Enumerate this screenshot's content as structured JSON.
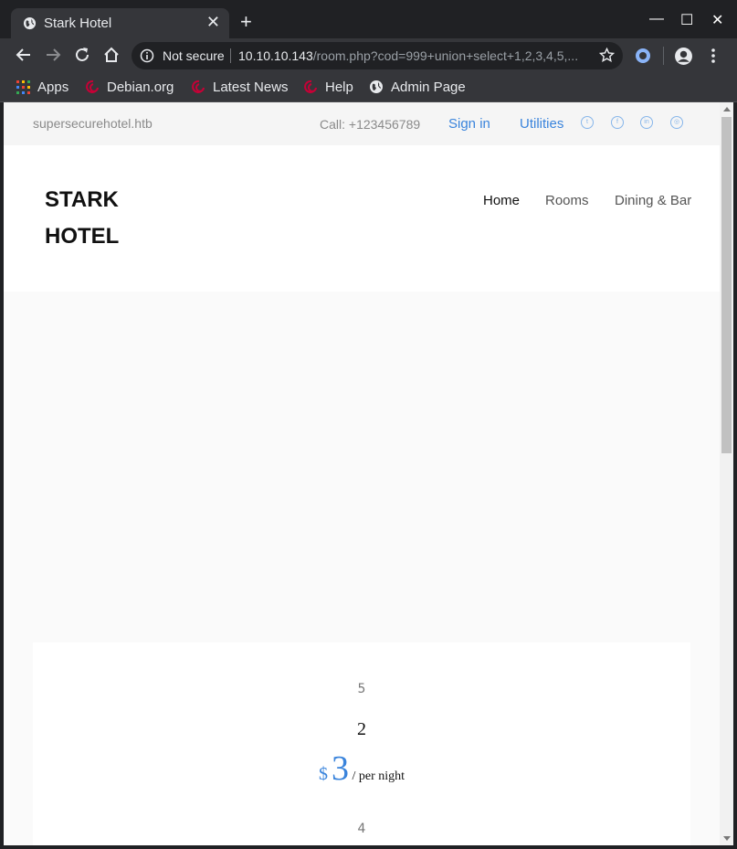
{
  "browser": {
    "tab_title": "Stark Hotel",
    "new_tab_symbol": "+",
    "close_symbol": "✕",
    "window_controls": {
      "minimize": "—",
      "maximize": "☐",
      "close": "✕"
    },
    "security_label": "Not secure",
    "url_host": "10.10.10.143",
    "url_path": "/room.php?cod=999+union+select+1,2,3,4,5,...",
    "bookmarks": [
      {
        "label": "Apps",
        "icon": "apps-grid-icon"
      },
      {
        "label": "Debian.org",
        "icon": "debian-icon"
      },
      {
        "label": "Latest News",
        "icon": "debian-icon"
      },
      {
        "label": "Help",
        "icon": "debian-icon"
      },
      {
        "label": "Admin Page",
        "icon": "globe-icon"
      }
    ]
  },
  "site": {
    "domain": "supersecurehotel.htb",
    "call": "Call: +123456789",
    "sign_in": "Sign in",
    "utilities": "Utilities",
    "social_icons": [
      "twitter-icon",
      "facebook-icon",
      "linkedin-icon",
      "dribbble-icon"
    ],
    "logo_line1": "STARK",
    "logo_line2": "HOTEL",
    "menu": [
      {
        "label": "Home",
        "active": true
      },
      {
        "label": "Rooms",
        "active": false
      },
      {
        "label": "Dining & Bar",
        "active": false
      }
    ]
  },
  "room": {
    "name": "5",
    "title": "2",
    "currency": "$",
    "price": "3",
    "per_night": " / per night",
    "description": "4"
  },
  "colors": {
    "accent": "#3a84dc",
    "chrome_dark": "#202124",
    "chrome_mid": "#35363a"
  }
}
